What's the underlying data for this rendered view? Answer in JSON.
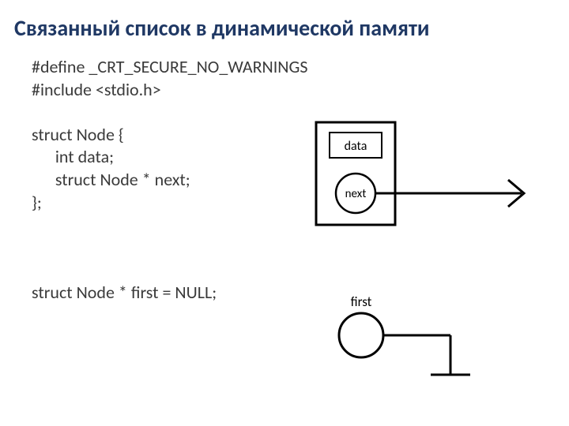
{
  "title": "Связанный список в динамической памяти",
  "code": {
    "l1": "#define _CRT_SECURE_NO_WARNINGS",
    "l2": "#include <stdio.h>",
    "l3": "",
    "l4": "struct Node {",
    "l5": "      int data;",
    "l6": "      struct Node * next;",
    "l7": "};",
    "l8": "",
    "l9": "",
    "l10": "",
    "l11": "struct Node * first = NULL;"
  },
  "diagram": {
    "node_data_label": "data",
    "node_next_label": "next",
    "first_label": "first"
  }
}
